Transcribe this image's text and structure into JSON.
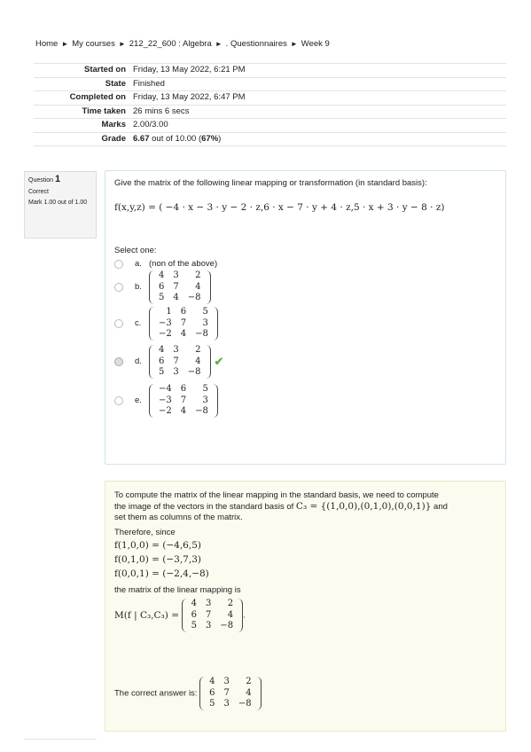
{
  "breadcrumb": [
    "Home",
    "My courses",
    "212_22_600 : Algebra",
    ". Questionnaires",
    "Week 9"
  ],
  "breadcrumb_sep": "►",
  "summary": [
    {
      "label": "Started on",
      "value": "Friday, 13 May 2022, 6:21 PM"
    },
    {
      "label": "State",
      "value": "Finished"
    },
    {
      "label": "Completed on",
      "value": "Friday, 13 May 2022, 6:47 PM"
    },
    {
      "label": "Time taken",
      "value": "26 mins 6 secs"
    },
    {
      "label": "Marks",
      "value": "2.00/3.00"
    },
    {
      "label": "Grade",
      "value_bold": "6.67",
      "value_mid": " out of 10.00 (",
      "value_pct": "67%",
      "value_end": ")"
    }
  ],
  "question_info": {
    "label": "Question",
    "number": "1",
    "state": "Correct",
    "mark": "Mark 1.00 out of 1.00"
  },
  "question": {
    "text": "Give the matrix of the following linear mapping or transformation (in standard basis):",
    "function": "f(x,y,z) = ( −4 · x − 3 · y − 2 · z,6 · x − 7 · y + 4 · z,5 · x + 3 · y − 8 · z)",
    "select_one": "Select one:",
    "options": [
      {
        "letter": "a.",
        "text": "(non of the above)",
        "checked": false
      },
      {
        "letter": "b.",
        "matrix": [
          [
            "4",
            "3",
            "2"
          ],
          [
            "6",
            "7",
            "4"
          ],
          [
            "5",
            "4",
            "−8"
          ]
        ],
        "checked": false
      },
      {
        "letter": "c.",
        "matrix": [
          [
            "1",
            "6",
            "5"
          ],
          [
            "−3",
            "7",
            "3"
          ],
          [
            "−2",
            "4",
            "−8"
          ]
        ],
        "checked": false
      },
      {
        "letter": "d.",
        "matrix": [
          [
            "4",
            "3",
            "2"
          ],
          [
            "6",
            "7",
            "4"
          ],
          [
            "5",
            "3",
            "−8"
          ]
        ],
        "checked": true,
        "correct_mark": "✔"
      },
      {
        "letter": "e.",
        "matrix": [
          [
            "−4",
            "6",
            "5"
          ],
          [
            "−3",
            "7",
            "3"
          ],
          [
            "−2",
            "4",
            "−8"
          ]
        ],
        "checked": false
      }
    ]
  },
  "feedback": {
    "intro1": "To compute the matrix of the linear mapping in the standard basis, we need to compute",
    "intro2a": "the image of the vectors in the standard basis of ",
    "basis": "C₃ = {(1,0,0),(0,1,0),(0,0,1)}",
    "intro2b": " and",
    "intro3": "set them as columns of the matrix.",
    "therefore": "Therefore, since",
    "images": [
      "f(1,0,0) = (−4,6,5)",
      "f(0,1,0) = (−3,7,3)",
      "f(0,0,1) = (−2,4,−8)"
    ],
    "matrix_label": "the matrix of the linear mapping is",
    "m_expr": "M(f | C₃,C₃) =",
    "m_matrix": [
      [
        "4",
        "3",
        "2"
      ],
      [
        "6",
        "7",
        "4"
      ],
      [
        "5",
        "3",
        "−8"
      ]
    ],
    "period": ".",
    "correct_answer_label": "The correct answer is:",
    "correct_matrix": [
      [
        "4",
        "3",
        "2"
      ],
      [
        "6",
        "7",
        "4"
      ],
      [
        "5",
        "3",
        "−8"
      ]
    ]
  }
}
